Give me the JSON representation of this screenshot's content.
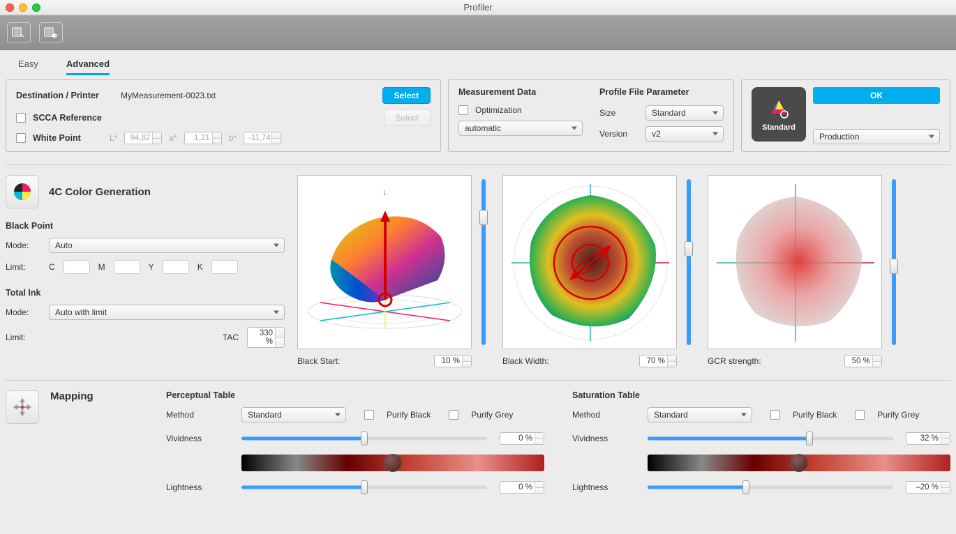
{
  "window": {
    "title": "Profiler"
  },
  "tabs": {
    "easy": "Easy",
    "advanced": "Advanced"
  },
  "dest": {
    "heading": "Destination / Printer",
    "file": "MyMeasurement-0023.txt",
    "select_btn": "Select",
    "scca_label": "SCCA Reference",
    "scca_select_btn": "Select",
    "white_point_label": "White Point",
    "L_label": "L*",
    "L_val": "94,82",
    "a_label": "a*",
    "a_val": "1,21",
    "b_label": "b*",
    "b_val": "-11,74"
  },
  "meas": {
    "heading": "Measurement Data",
    "optimization_label": "Optimization",
    "optimization_select": "automatic",
    "pfp_heading": "Profile File Parameter",
    "size_label": "Size",
    "size_value": "Standard",
    "version_label": "Version",
    "version_value": "v2"
  },
  "profile": {
    "icon_label": "Standard",
    "ok": "OK",
    "mode": "Production"
  },
  "fourc": {
    "title": "4C Color Generation",
    "black_point_heading": "Black Point",
    "mode_label": "Mode:",
    "black_mode": "Auto",
    "limit_label": "Limit:",
    "C": "C",
    "M": "M",
    "Y": "Y",
    "K": "K",
    "total_ink_heading": "Total Ink",
    "total_mode": "Auto with limit",
    "tac_label": "TAC",
    "tac_val": "330 %",
    "black_start_label": "Black Start:",
    "black_start_val": "10 %",
    "black_width_label": "Black Width:",
    "black_width_val": "70 %",
    "gcr_label": "GCR strength:",
    "gcr_val": "50 %"
  },
  "mapping": {
    "title": "Mapping",
    "perceptual_heading": "Perceptual Table",
    "saturation_heading": "Saturation Table",
    "method_label": "Method",
    "method_value_p": "Standard",
    "method_value_s": "Standard",
    "purify_black": "Purify Black",
    "purify_grey": "Purify Grey",
    "vividness_label": "Vividness",
    "lightness_label": "Lightness",
    "p_vividness": "0 %",
    "p_lightness": "0 %",
    "s_vividness": "32 %",
    "s_lightness": "–20 %"
  }
}
